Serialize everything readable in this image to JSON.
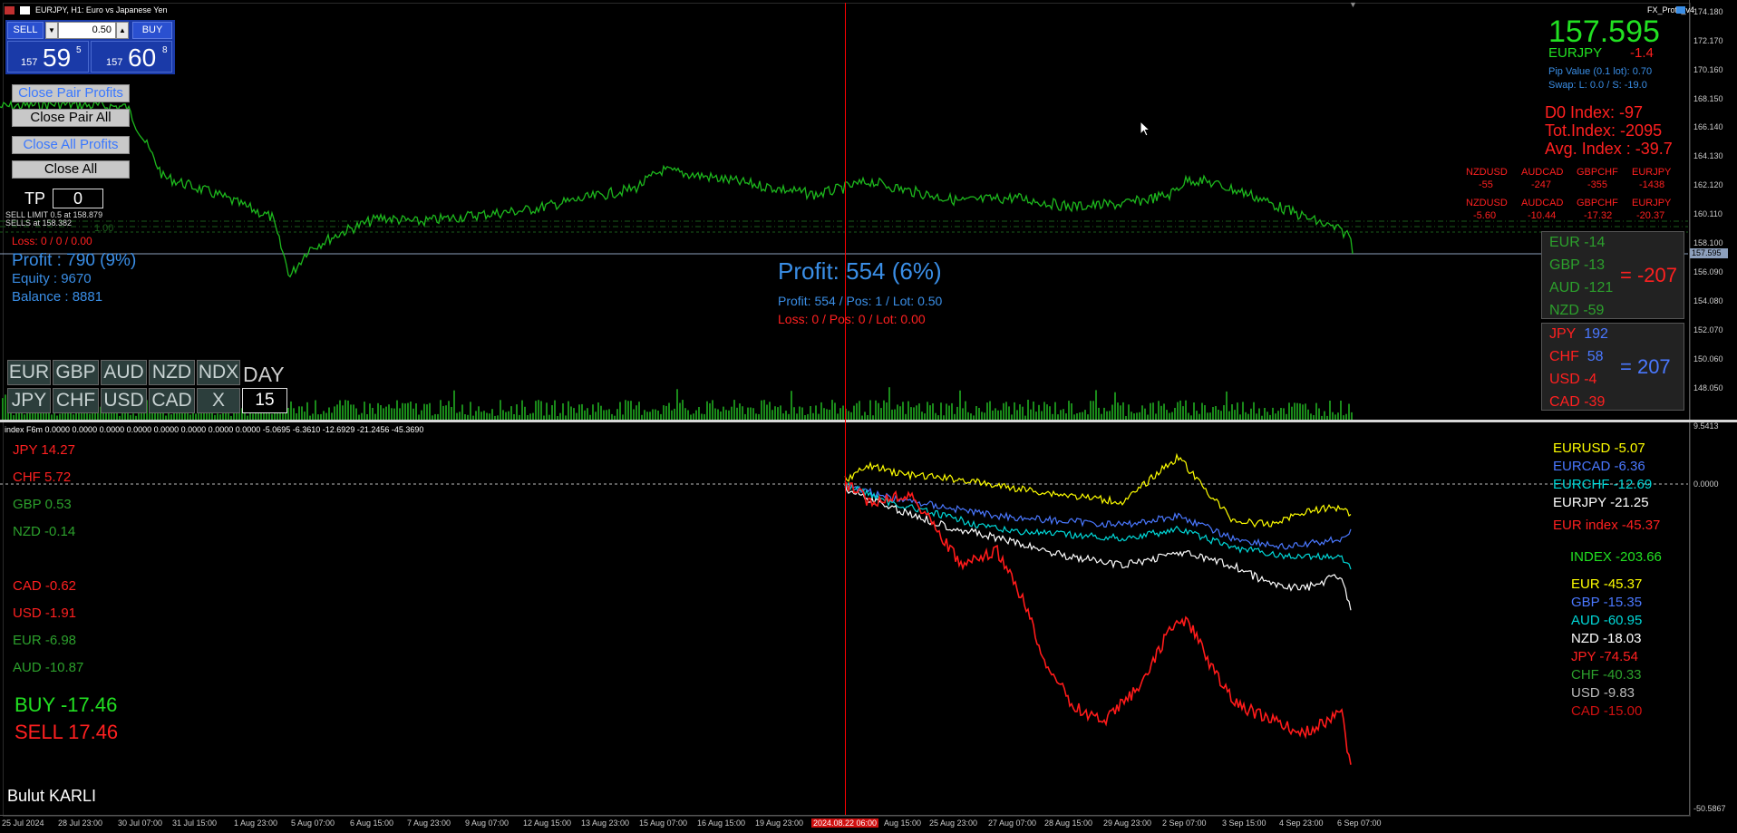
{
  "title": "EURJPY, H1:  Euro vs Japanese Yen",
  "indicator_name": "FX_Profit_v4",
  "one_click": {
    "sell_label": "SELL",
    "buy_label": "BUY",
    "lot": "0.50",
    "sell_prefix": "157",
    "sell_big": "59",
    "sell_sup": "5",
    "buy_prefix": "157",
    "buy_big": "60",
    "buy_sup": "8"
  },
  "buttons": {
    "close_pair_profits": "Close Pair Profits",
    "close_pair_all": "Close Pair All",
    "close_all_profits": "Close All Profits",
    "close_all": "Close All"
  },
  "tp": {
    "label": "TP",
    "value": "0"
  },
  "order_lines": {
    "sell_limit": "SELL LIMIT 0.5 at 158.879",
    "sells": "SELLS at 158.382",
    "sells_extra": "1.00"
  },
  "left_info": {
    "loss": "Loss: 0 / 0 / 0.00",
    "profit": "Profit : 790 (9%)",
    "equity": "Equity    : 9670",
    "balance": "Balance : 8881"
  },
  "center_info": {
    "profit_big": "Profit: 554 (6%)",
    "profit_line": "Profit: 554 / Pos: 1 / Lot: 0.50",
    "loss_line": "Loss: 0 / Pos: 0 / Lot: 0.00"
  },
  "currency_buttons": {
    "row1": [
      "EUR",
      "GBP",
      "AUD",
      "NZD",
      "NDX"
    ],
    "row2": [
      "JPY",
      "CHF",
      "USD",
      "CAD",
      "X"
    ],
    "day_label": "DAY",
    "day_value": "15"
  },
  "top_right": {
    "price": "157.595",
    "symbol": "EURJPY",
    "change": "-1.4",
    "pip_value": "Pip Value (0.1 lot): 0.70",
    "swap": "Swap: L: 0.0 / S: -19.0",
    "d0_index": "D0 Index: -97",
    "tot_index": "Tot.Index: -2095",
    "avg_index": "Avg. Index : -39.7"
  },
  "pair_grid": {
    "row1_names": [
      "NZDUSD",
      "AUDCAD",
      "GBPCHF",
      "EURJPY"
    ],
    "row1_values": [
      "-55",
      "-247",
      "-355",
      "-1438"
    ],
    "row2_names": [
      "NZDUSD",
      "AUDCAD",
      "GBPCHF",
      "EURJPY"
    ],
    "row2_values": [
      "-5.60",
      "-10.44",
      "-17.32",
      "-20.37"
    ]
  },
  "panel_a": {
    "items": [
      {
        "label": "EUR  -14"
      },
      {
        "label": "GBP  -13"
      },
      {
        "label": "AUD  -121"
      },
      {
        "label": "NZD  -59"
      }
    ],
    "total": "= -207"
  },
  "panel_b": {
    "items": [
      {
        "label": "JPY",
        "value": "192"
      },
      {
        "label": "CHF",
        "value": "58"
      },
      {
        "label": "USD  -4"
      },
      {
        "label": "CAD  -39"
      }
    ],
    "total": "= 207"
  },
  "price_axis": [
    "174.180",
    "172.170",
    "170.160",
    "168.150",
    "166.140",
    "164.130",
    "162.120",
    "160.110",
    "158.100",
    "156.090",
    "154.080",
    "152.070",
    "150.060",
    "148.050"
  ],
  "current_price_tag": "157.595",
  "lower_axis": {
    "top": "9.5413",
    "zero": "0.0000",
    "bottom": "-50.5867"
  },
  "indicator_header": "index F6m 0.0000 0.0000 0.0000 0.0000 0.0000 0.0000 0.0000 0.0000 -5.0695 -6.3610 -12.6929 -21.2456 -45.3690",
  "lower_left": {
    "items": [
      {
        "label": "JPY  14.27",
        "color": "#ff2020"
      },
      {
        "label": "CHF  5.72",
        "color": "#ff2020"
      },
      {
        "label": "GBP  0.53",
        "color": "#2ca02c"
      },
      {
        "label": "NZD  -0.14",
        "color": "#2ca02c"
      },
      {
        "label": "CAD  -0.62",
        "color": "#ff2020"
      },
      {
        "label": "USD  -1.91",
        "color": "#ff2020"
      },
      {
        "label": "EUR  -6.98",
        "color": "#2ca02c"
      },
      {
        "label": "AUD  -10.87",
        "color": "#2ca02c"
      }
    ],
    "buy": "BUY    -17.46",
    "sell": "SELL   17.46",
    "author": "Bulut KARLI"
  },
  "lower_right": {
    "pairs": [
      {
        "label": "EURUSD   -5.07",
        "color": "#ffff00"
      },
      {
        "label": "EURCAD   -6.36",
        "color": "#4a78ff"
      },
      {
        "label": "EURCHF   -12.69",
        "color": "#00d8d8"
      },
      {
        "label": "EURJPY   -21.25",
        "color": "#ffffff"
      },
      {
        "label": "EUR index  -45.37",
        "color": "#ff2020"
      }
    ],
    "index": "INDEX  -203.66",
    "currencies": [
      {
        "label": "EUR   -45.37",
        "color": "#ffff00"
      },
      {
        "label": "GBP   -15.35",
        "color": "#4a78ff"
      },
      {
        "label": "AUD   -60.95",
        "color": "#00d8d8"
      },
      {
        "label": "NZD   -18.03",
        "color": "#ffffff"
      },
      {
        "label": "JPY   -74.54",
        "color": "#ff2020"
      },
      {
        "label": "CHF   -40.33",
        "color": "#2ca02c"
      },
      {
        "label": "USD   -9.83",
        "color": "#bbbbbb"
      },
      {
        "label": "CAD   -15.00",
        "color": "#d01010"
      }
    ]
  },
  "time_axis": [
    "25 Jul 2024",
    "28 Jul 23:00",
    "30 Jul 07:00",
    "31 Jul 15:00",
    "1 Aug 23:00",
    "5 Aug 07:00",
    "6 Aug 15:00",
    "7 Aug 23:00",
    "9 Aug 07:00",
    "12 Aug 15:00",
    "13 Aug 23:00",
    "15 Aug 07:00",
    "16 Aug 15:00",
    "19 Aug 23:00",
    "2024.08.22 06:00",
    "Aug 15:00",
    "25 Aug 23:00",
    "27 Aug 07:00",
    "28 Aug 15:00",
    "29 Aug 23:00",
    "2 Sep 07:00",
    "3 Sep 15:00",
    "4 Sep 23:00",
    "6 Sep 07:00"
  ],
  "colors": {
    "price_line": "#1db81d",
    "cursor_line": "#ff0000",
    "profit_blue": "#3a8ee6",
    "loss_red": "#ff2020"
  }
}
